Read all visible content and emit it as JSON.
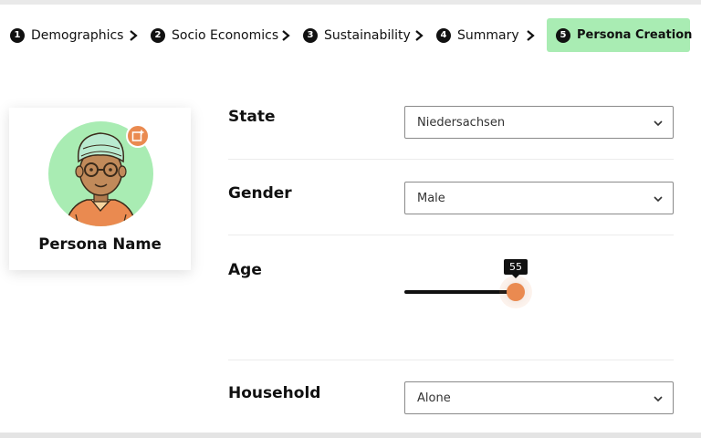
{
  "stepper": {
    "steps": [
      {
        "num": "1",
        "label": "Demographics"
      },
      {
        "num": "2",
        "label": "Socio Economics"
      },
      {
        "num": "3",
        "label": "Sustainability"
      },
      {
        "num": "4",
        "label": "Summary"
      },
      {
        "num": "5",
        "label": "Persona Creation"
      }
    ],
    "active_index": 4,
    "active_color": "#a9ecb3"
  },
  "persona": {
    "name": "Persona Name",
    "avatar_icon": "persona-avatar",
    "upload_icon": "image-upload-icon",
    "accent": "#ea8a50"
  },
  "form": {
    "state": {
      "label": "State",
      "value": "Niedersachsen"
    },
    "gender": {
      "label": "Gender",
      "value": "Male"
    },
    "age": {
      "label": "Age",
      "value": "55"
    },
    "household": {
      "label": "Household",
      "value": "Alone"
    }
  }
}
